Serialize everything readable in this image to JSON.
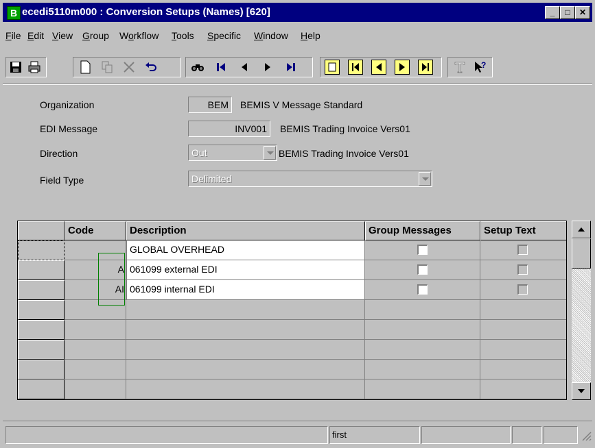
{
  "window": {
    "title": "ecedi5110m000 : Conversion Setups (Names) [620]",
    "app_icon_letter": "B",
    "controls": {
      "minimize": "_",
      "maximize": "□",
      "close": "✕"
    }
  },
  "menu": [
    {
      "label": "File",
      "underline": "F",
      "rest": "ile"
    },
    {
      "label": "Edit",
      "underline": "E",
      "rest": "dit"
    },
    {
      "label": "View",
      "underline": "V",
      "rest": "iew"
    },
    {
      "label": "Group",
      "underline": "G",
      "rest": "roup"
    },
    {
      "label": "Workflow",
      "pre": "W",
      "underline": "o",
      "rest": "rkflow"
    },
    {
      "label": "Tools",
      "underline": "T",
      "rest": "ools"
    },
    {
      "label": "Specific",
      "underline": "S",
      "rest": "pecific"
    },
    {
      "label": "Window",
      "underline": "W",
      "rest": "indow"
    },
    {
      "label": "Help",
      "underline": "H",
      "rest": "elp"
    }
  ],
  "toolbar": {
    "icons": [
      "save-icon",
      "print-icon",
      "new-icon",
      "copy-icon",
      "delete-icon",
      "undo-icon",
      "find-icon",
      "first-record-icon",
      "previous-record-icon",
      "next-record-icon",
      "last-record-icon",
      "session-icon-1",
      "session-icon-2",
      "session-icon-3",
      "session-icon-4",
      "session-icon-5",
      "text-icon",
      "help-pointer-icon"
    ]
  },
  "form": {
    "organization": {
      "label": "Organization",
      "value": "BEM",
      "description": "BEMIS V Message Standard"
    },
    "edi_message": {
      "label": "EDI Message",
      "value": "INV001",
      "description": "BEMIS Trading Invoice Vers01"
    },
    "direction": {
      "label": "Direction",
      "value": "Out",
      "description": "BEMIS Trading Invoice Vers01"
    },
    "field_type": {
      "label": "Field Type",
      "value": "Delimited"
    }
  },
  "grid": {
    "columns": [
      "Code",
      "Description",
      "Group Messages",
      "Setup Text"
    ],
    "rows": [
      {
        "code": "",
        "description": "GLOBAL OVERHEAD",
        "group_messages": false,
        "setup_text": false
      },
      {
        "code": "A",
        "description": "061099 external EDI",
        "group_messages": false,
        "setup_text": false
      },
      {
        "code": "AI",
        "description": "061099 internal EDI",
        "group_messages": false,
        "setup_text": false
      }
    ],
    "empty_rows": 5
  },
  "status": {
    "record_position": "first"
  }
}
